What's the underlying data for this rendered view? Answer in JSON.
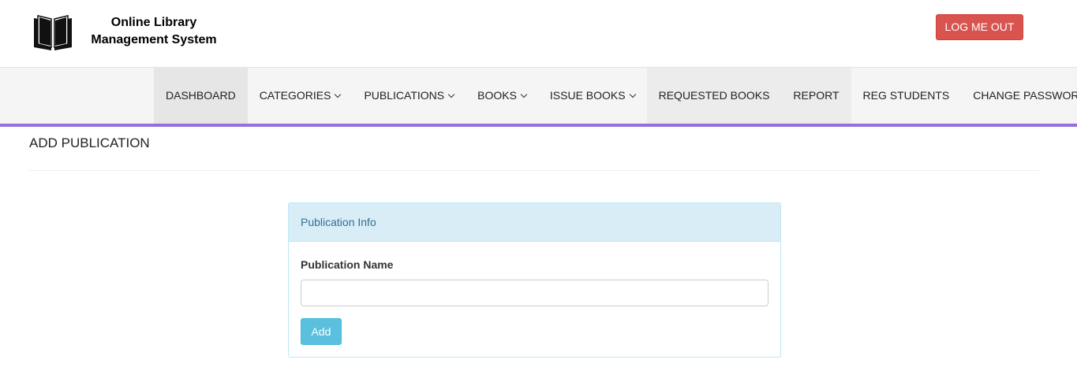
{
  "header": {
    "brand_line1": "Online Library",
    "brand_line2": "Management System",
    "logo_icon": "book-icon",
    "logout_label": "LOG ME OUT"
  },
  "nav": {
    "items": [
      {
        "label": "DASHBOARD",
        "dropdown": false,
        "active": true
      },
      {
        "label": "CATEGORIES",
        "dropdown": true
      },
      {
        "label": "PUBLICATIONS",
        "dropdown": true
      },
      {
        "label": "BOOKS",
        "dropdown": true
      },
      {
        "label": "ISSUE BOOKS",
        "dropdown": true
      },
      {
        "label": "REQUESTED BOOKS",
        "dropdown": false
      },
      {
        "label": "REPORT",
        "dropdown": false
      },
      {
        "label": "REG STUDENTS",
        "dropdown": false
      },
      {
        "label": "CHANGE PASSWORD",
        "dropdown": false
      }
    ],
    "dropdown_icon": "chevron-down-icon",
    "accent_color": "#9370db"
  },
  "page": {
    "title": "ADD PUBLICATION"
  },
  "panel": {
    "heading": "Publication Info",
    "field_label": "Publication Name",
    "field_value": "",
    "field_placeholder": "",
    "submit_label": "Add"
  },
  "colors": {
    "logout": "#d9534f",
    "panel_heading_bg": "#d9edf7",
    "add_button": "#5bc0de"
  }
}
